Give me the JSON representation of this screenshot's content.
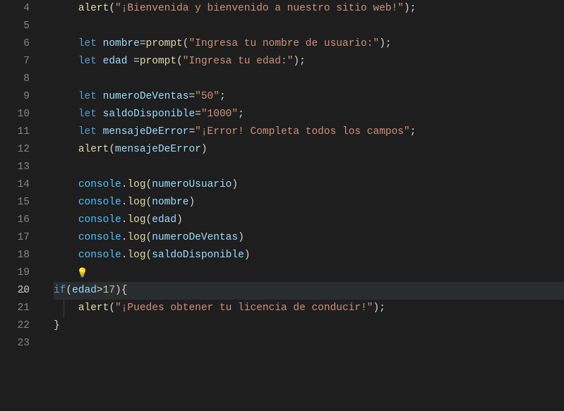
{
  "first_line": 4,
  "active_line": 20,
  "fold_line": 20,
  "bulb_line": 19,
  "lines": [
    {
      "n": 4,
      "tokens": [
        [
          "fn",
          "alert"
        ],
        [
          "pun",
          "("
        ],
        [
          "str",
          "\"¡Bienvenida y bienvenido a nuestro sitio web!\""
        ],
        [
          "pun",
          ")"
        ],
        [
          "pun",
          ";"
        ]
      ]
    },
    {
      "n": 5,
      "tokens": []
    },
    {
      "n": 6,
      "tokens": [
        [
          "kw",
          "let"
        ],
        [
          "pun",
          " "
        ],
        [
          "var",
          "nombre"
        ],
        [
          "op",
          "="
        ],
        [
          "fn",
          "prompt"
        ],
        [
          "pun",
          "("
        ],
        [
          "str",
          "\"Ingresa tu nombre de usuario:\""
        ],
        [
          "pun",
          ")"
        ],
        [
          "pun",
          ";"
        ]
      ]
    },
    {
      "n": 7,
      "tokens": [
        [
          "kw",
          "let"
        ],
        [
          "pun",
          " "
        ],
        [
          "var",
          "edad"
        ],
        [
          "pun",
          " "
        ],
        [
          "op",
          "="
        ],
        [
          "fn",
          "prompt"
        ],
        [
          "pun",
          "("
        ],
        [
          "str",
          "\"Ingresa tu edad:\""
        ],
        [
          "pun",
          ")"
        ],
        [
          "pun",
          ";"
        ]
      ]
    },
    {
      "n": 8,
      "tokens": []
    },
    {
      "n": 9,
      "tokens": [
        [
          "kw",
          "let"
        ],
        [
          "pun",
          " "
        ],
        [
          "var",
          "numeroDeVentas"
        ],
        [
          "op",
          "="
        ],
        [
          "str",
          "\"50\""
        ],
        [
          "pun",
          ";"
        ]
      ]
    },
    {
      "n": 10,
      "tokens": [
        [
          "kw",
          "let"
        ],
        [
          "pun",
          " "
        ],
        [
          "var",
          "saldoDisponible"
        ],
        [
          "op",
          "="
        ],
        [
          "str",
          "\"1000\""
        ],
        [
          "pun",
          ";"
        ]
      ]
    },
    {
      "n": 11,
      "tokens": [
        [
          "kw",
          "let"
        ],
        [
          "pun",
          " "
        ],
        [
          "var",
          "mensajeDeError"
        ],
        [
          "op",
          "="
        ],
        [
          "str",
          "\"¡Error! Completa todos los campos\""
        ],
        [
          "pun",
          ";"
        ]
      ]
    },
    {
      "n": 12,
      "tokens": [
        [
          "fn",
          "alert"
        ],
        [
          "pun",
          "("
        ],
        [
          "var",
          "mensajeDeError"
        ],
        [
          "pun",
          ")"
        ]
      ]
    },
    {
      "n": 13,
      "tokens": []
    },
    {
      "n": 14,
      "tokens": [
        [
          "obj",
          "console"
        ],
        [
          "pun",
          "."
        ],
        [
          "fn",
          "log"
        ],
        [
          "pun",
          "("
        ],
        [
          "var",
          "numeroUsuario"
        ],
        [
          "pun",
          ")"
        ]
      ]
    },
    {
      "n": 15,
      "tokens": [
        [
          "obj",
          "console"
        ],
        [
          "pun",
          "."
        ],
        [
          "fn",
          "log"
        ],
        [
          "pun",
          "("
        ],
        [
          "var",
          "nombre"
        ],
        [
          "pun",
          ")"
        ]
      ]
    },
    {
      "n": 16,
      "tokens": [
        [
          "obj",
          "console"
        ],
        [
          "pun",
          "."
        ],
        [
          "fn",
          "log"
        ],
        [
          "pun",
          "("
        ],
        [
          "var",
          "edad"
        ],
        [
          "pun",
          ")"
        ]
      ]
    },
    {
      "n": 17,
      "tokens": [
        [
          "obj",
          "console"
        ],
        [
          "pun",
          "."
        ],
        [
          "fn",
          "log"
        ],
        [
          "pun",
          "("
        ],
        [
          "var",
          "numeroDeVentas"
        ],
        [
          "pun",
          ")"
        ]
      ]
    },
    {
      "n": 18,
      "tokens": [
        [
          "obj",
          "console"
        ],
        [
          "pun",
          "."
        ],
        [
          "fn",
          "log"
        ],
        [
          "pun",
          "("
        ],
        [
          "var",
          "saldoDisponible"
        ],
        [
          "pun",
          ")"
        ]
      ]
    },
    {
      "n": 19,
      "tokens": []
    },
    {
      "n": 20,
      "indent": 0,
      "tokens": [
        [
          "kw",
          "if"
        ],
        [
          "pun",
          "("
        ],
        [
          "var",
          "edad"
        ],
        [
          "op",
          ">"
        ],
        [
          "num",
          "17"
        ],
        [
          "pun",
          ")"
        ],
        [
          "pun",
          "{"
        ]
      ]
    },
    {
      "n": 21,
      "indent": 1,
      "guide": true,
      "tokens": [
        [
          "fn",
          "alert"
        ],
        [
          "pun",
          "("
        ],
        [
          "str",
          "\"¡Puedes obtener tu licencia de conducir!\""
        ],
        [
          "pun",
          ")"
        ],
        [
          "pun",
          ";"
        ]
      ]
    },
    {
      "n": 22,
      "indent": 0,
      "tokens": [
        [
          "pun",
          "}"
        ]
      ]
    },
    {
      "n": 23,
      "tokens": []
    }
  ]
}
